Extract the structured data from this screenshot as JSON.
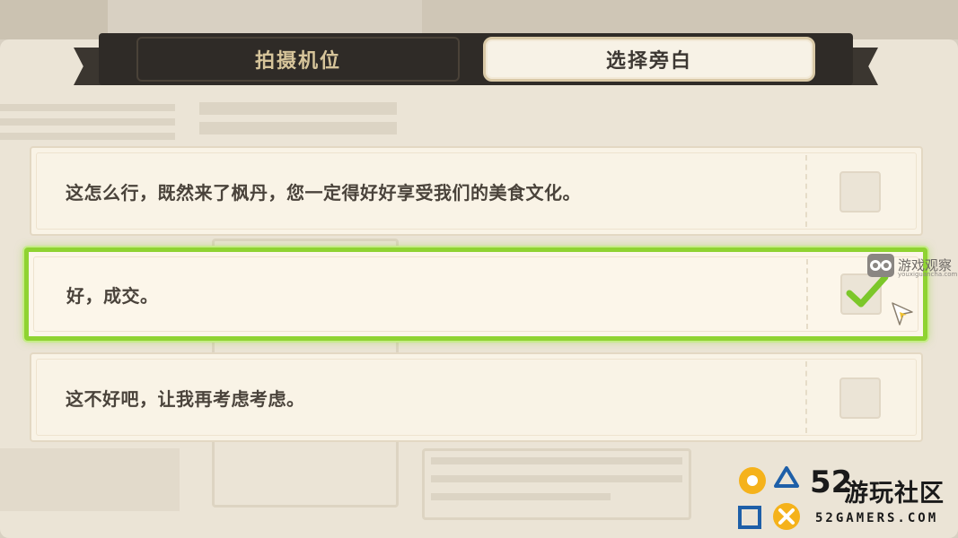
{
  "tabs": [
    {
      "label": "拍摄机位",
      "active": false
    },
    {
      "label": "选择旁白",
      "active": true
    }
  ],
  "options": [
    {
      "text": "这怎么行，既然来了枫丹，您一定得好好享受我们的美食文化。",
      "checked": false
    },
    {
      "text": "好，成交。",
      "checked": true
    },
    {
      "text": "这不好吧，让我再考虑考虑。",
      "checked": false
    }
  ],
  "watermarks": {
    "top": {
      "name": "游戏观察",
      "url": "youxiguancha.com"
    },
    "bottom": {
      "number": "52",
      "name": "游玩社区",
      "url": "52GAMERS.COM"
    }
  },
  "colors": {
    "selected_border": "#8fd332",
    "checkmark": "#7cc72a",
    "tab_bar": "#2f2b27",
    "inactive_tab_text": "#d6c49a",
    "option_bg": "#f9f3e6"
  },
  "icons": [
    "checkmark-icon",
    "cursor-icon",
    "checkbox-icon"
  ]
}
